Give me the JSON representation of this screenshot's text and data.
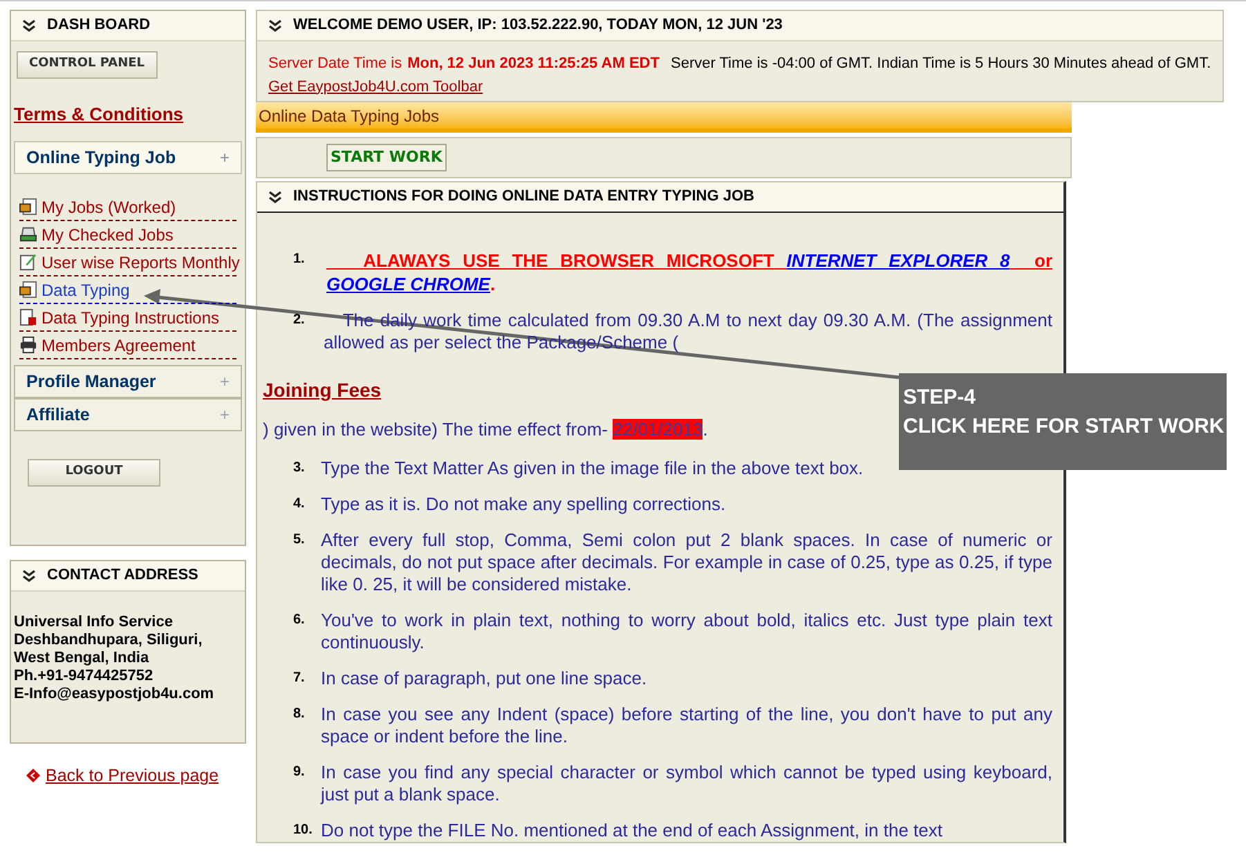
{
  "sidebar": {
    "dashboard_title": "DASH BOARD",
    "control_panel_button": "CONTROL PANEL",
    "terms_link": "Terms & Conditions",
    "menus": [
      {
        "label": "Online Typing Job",
        "icon": "+",
        "expanded": true,
        "items": [
          {
            "label": "My Jobs (Worked)",
            "kind": "card",
            "selected": false
          },
          {
            "label": "My Checked Jobs",
            "kind": "tray",
            "selected": false
          },
          {
            "label": "User wise Reports Monthly",
            "kind": "note",
            "selected": false
          },
          {
            "label": "Data Typing",
            "kind": "card",
            "selected": true
          },
          {
            "label": "Data Typing Instructions",
            "kind": "lock",
            "selected": false
          },
          {
            "label": "Members Agreement",
            "kind": "printer",
            "selected": false
          }
        ]
      },
      {
        "label": "Profile Manager",
        "icon": "+",
        "expanded": false
      },
      {
        "label": "Affiliate",
        "icon": "+",
        "expanded": false
      }
    ],
    "logout_button": "LOGOUT",
    "contact": {
      "title": "CONTACT ADDRESS",
      "lines": [
        "Universal Info Service",
        "Deshbandhupara, Siliguri,",
        "West Bengal, India",
        "Ph.+91-9474425752",
        "E-Info@easypostjob4u.com"
      ]
    },
    "back_link": "Back to Previous page"
  },
  "welcome": {
    "title": "WELCOME DEMO USER, IP: 103.52.222.90, TODAY MON, 12 JUN '23",
    "server_label": "Server Date Time is",
    "server_time": "Mon, 12 Jun 2023 11:25:25 AM EDT",
    "server_note": "Server Time is -04:00 of GMT. Indian Time is 5 Hours 30 Minutes ahead of GMT.",
    "toolbar_link": "Get EaypostJob4U.com Toolbar"
  },
  "jobs_bar": "Online Data Typing Jobs",
  "start_button": "START WORK",
  "instructions": {
    "title": "INSTRUCTIONS FOR DOING ONLINE DATA ENTRY TYPING JOB",
    "item_1": {
      "number": "1.",
      "warning": "ALAWAYS USE THE BROWSER MICROSOFT",
      "link_1": "INTERNET EXPLORER 8",
      "or": "or",
      "link_2": "GOOGLE CHROME",
      "end": "."
    },
    "item_2": {
      "number": "2.",
      "text": "The daily work time calculated from 09.30 A.M to next day 09.30 A.M. (The assignment  allowed as per select the Package/Scheme ("
    },
    "joining_fees": "Joining Fees",
    "effect_text": ") given in the website) The time effect from-",
    "effect_date": "22/01/2013",
    "effect_end": ".",
    "items": [
      {
        "number": "3.",
        "text": "Type the Text Matter As given in the image file in the above text box."
      },
      {
        "number": "4.",
        "text": "Type as it is. Do not make any spelling corrections."
      },
      {
        "number": "5.",
        "text": "After every full stop, Comma, Semi colon put 2 blank spaces. In case of numeric or decimals, do not put space after decimals. For example in case of 0.25, type as 0.25, if type like 0. 25, it will be considered mistake."
      },
      {
        "number": "6.",
        "text": "You've to work in plain text, nothing to worry about bold, italics etc. Just type plain text continuously."
      },
      {
        "number": "7.",
        "text": "In case of paragraph, put one line space."
      },
      {
        "number": "8.",
        "text": "In case you see any Indent (space) before starting of the line, you don't have to put any space or indent before the line."
      },
      {
        "number": "9.",
        "text": "In case you find any special character or symbol which cannot be typed using keyboard, just put a blank space."
      },
      {
        "number": "10.",
        "text": "Do not type the FILE No. mentioned at the end of each Assignment, in the text"
      }
    ]
  },
  "callout": {
    "title": "STEP-4",
    "text": "CLICK HERE FOR START WORK"
  }
}
